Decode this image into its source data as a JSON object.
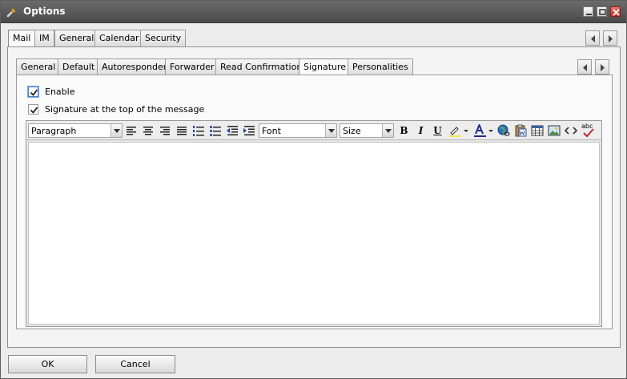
{
  "window": {
    "title": "Options"
  },
  "outer_tabs": [
    "Mail",
    "IM",
    "General",
    "Calendar",
    "Security"
  ],
  "outer_active": "Mail",
  "inner_tabs": [
    "General",
    "Default",
    "Autoresponder",
    "Forwarder",
    "Read Confirmation",
    "Signature",
    "Personalities"
  ],
  "inner_active": "Signature",
  "signature": {
    "enable_label": "Enable",
    "enable_checked": true,
    "top_label": "Signature at the top of the message",
    "top_checked": true
  },
  "editor": {
    "format_value": "Paragraph",
    "font_value": "Font",
    "size_value": "Size",
    "bold": "B",
    "italic": "I",
    "underline": "U",
    "spell": "abc"
  },
  "buttons": {
    "ok": "OK",
    "cancel": "Cancel"
  },
  "colors": {
    "titlebar": "#4a4a4a",
    "text_color_bar": "#1a2f8c",
    "highlight_bar": "#f7e64a"
  }
}
